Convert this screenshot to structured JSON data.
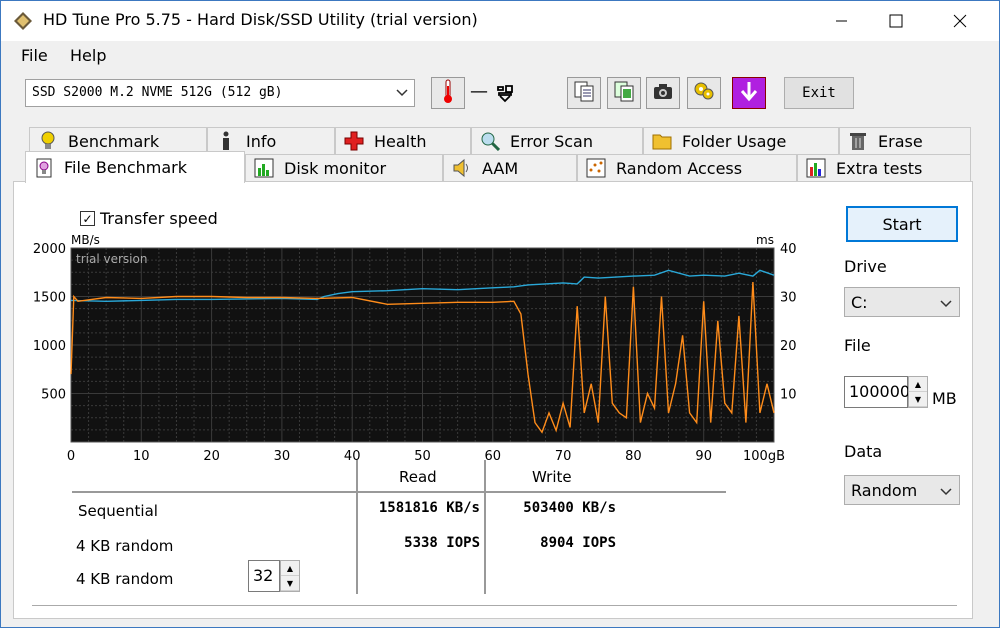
{
  "window": {
    "title": "HD Tune Pro 5.75 - Hard Disk/SSD Utility (trial version)"
  },
  "menu": {
    "file": "File",
    "help": "Help"
  },
  "toolbar": {
    "drive": "SSD S2000 M.2 NVME 512G (512 gB)",
    "temp_dash": "—",
    "exit": "Exit"
  },
  "tabs": {
    "row1": [
      "Benchmark",
      "Info",
      "Health",
      "Error Scan",
      "Folder Usage",
      "Erase"
    ],
    "row2": [
      "File Benchmark",
      "Disk monitor",
      "AAM",
      "Random Access",
      "Extra tests"
    ]
  },
  "panel": {
    "transfer_speed": "Transfer speed",
    "start": "Start",
    "drive_label": "Drive",
    "drive_value": "C:",
    "file_label": "File",
    "file_value": "100000",
    "file_unit": "MB",
    "data_label": "Data",
    "data_value": "Random"
  },
  "results": {
    "read_header": "Read",
    "write_header": "Write",
    "rows": [
      {
        "label": "Sequential",
        "read": "1581816 KB/s",
        "write": "503400 KB/s"
      },
      {
        "label": "4 KB random",
        "read": "5338 IOPS",
        "write": "8904 IOPS"
      },
      {
        "label": "4 KB random",
        "read": "",
        "write": "",
        "queue": "32"
      }
    ]
  },
  "chart_data": {
    "type": "line",
    "watermark": "trial version",
    "ylabel_left": "MB/s",
    "ylabel_right": "ms",
    "xlabel_unit": "gB",
    "ylim_left": [
      0,
      2000
    ],
    "ylim_right": [
      0,
      40
    ],
    "xlim": [
      0,
      100
    ],
    "y_ticks_left": [
      "2000",
      "1500",
      "1000",
      "500"
    ],
    "y_ticks_right": [
      "40",
      "30",
      "20",
      "10"
    ],
    "x_ticks": [
      "0",
      "10",
      "20",
      "30",
      "40",
      "50",
      "60",
      "70",
      "80",
      "90",
      "100gB"
    ],
    "grid": true,
    "series": [
      {
        "color": "#2aa8d8",
        "x": [
          0,
          5,
          10,
          15,
          20,
          25,
          30,
          35,
          36,
          38,
          40,
          45,
          50,
          55,
          60,
          63,
          65,
          70,
          72,
          73,
          75,
          80,
          83,
          85,
          88,
          90,
          93,
          95,
          97,
          98,
          100
        ],
        "y": [
          1460,
          1450,
          1460,
          1470,
          1470,
          1475,
          1480,
          1470,
          1500,
          1530,
          1550,
          1560,
          1580,
          1570,
          1590,
          1600,
          1620,
          1640,
          1630,
          1700,
          1690,
          1710,
          1720,
          1770,
          1710,
          1720,
          1710,
          1740,
          1710,
          1770,
          1720
        ]
      },
      {
        "color": "#ff8c1a",
        "x": [
          0,
          0.4,
          1,
          5,
          10,
          15,
          20,
          25,
          30,
          35,
          40,
          45,
          50,
          55,
          60,
          63,
          64,
          65,
          66,
          67,
          68,
          69,
          70,
          71,
          72,
          73,
          74,
          75,
          76,
          77,
          78,
          79,
          80,
          81,
          82,
          83,
          84,
          85,
          86,
          87,
          88,
          89,
          90,
          91,
          92,
          93,
          94,
          95,
          96,
          97,
          98,
          99,
          100
        ],
        "y": [
          700,
          1500,
          1450,
          1490,
          1480,
          1500,
          1500,
          1490,
          1490,
          1480,
          1490,
          1420,
          1430,
          1440,
          1440,
          1450,
          1320,
          700,
          200,
          100,
          300,
          120,
          400,
          150,
          1400,
          300,
          600,
          200,
          1500,
          400,
          300,
          250,
          1600,
          200,
          500,
          350,
          1500,
          300,
          600,
          1100,
          300,
          200,
          1450,
          200,
          1250,
          400,
          300,
          1300,
          200,
          1650,
          300,
          600,
          300
        ]
      }
    ]
  }
}
